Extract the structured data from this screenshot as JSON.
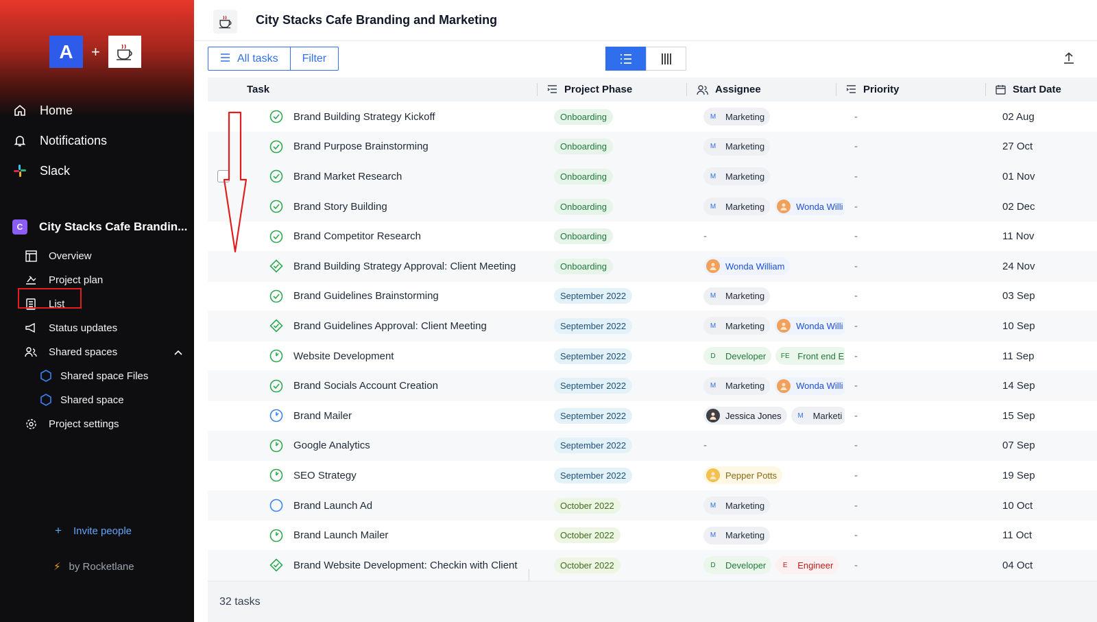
{
  "app": {
    "logo_letter": "A",
    "logo_plus": "+",
    "brand_color": "#2f5bea",
    "accent_color": "#2f6fed"
  },
  "sidebar": {
    "nav": [
      {
        "label": "Home",
        "icon": "home-icon"
      },
      {
        "label": "Notifications",
        "icon": "bell-icon"
      },
      {
        "label": "Slack",
        "icon": "slack-icon"
      }
    ],
    "project": {
      "badge": "C",
      "name": "City Stacks Cafe Brandin..."
    },
    "items": [
      {
        "label": "Overview",
        "icon": "overview-icon"
      },
      {
        "label": "Project plan",
        "icon": "project-plan-icon"
      },
      {
        "label": "List",
        "icon": "list-icon"
      },
      {
        "label": "Status updates",
        "icon": "megaphone-icon"
      },
      {
        "label": "Shared spaces",
        "icon": "people-icon"
      }
    ],
    "shared_spaces": [
      {
        "label": "Shared space Files",
        "icon": "hexagon-icon"
      },
      {
        "label": "Shared space",
        "icon": "hexagon-icon"
      }
    ],
    "settings": {
      "label": "Project settings",
      "icon": "gear-icon"
    },
    "invite": {
      "plus": "+",
      "label": "Invite people"
    },
    "powered": {
      "bolt": "⚡",
      "label": "by Rocketlane"
    }
  },
  "header": {
    "title": "City Stacks Cafe Branding and Marketing"
  },
  "toolbar": {
    "all_tasks": "All tasks",
    "filter": "Filter"
  },
  "table": {
    "columns": {
      "task": "Task",
      "phase": "Project Phase",
      "assignee": "Assignee",
      "priority": "Priority",
      "start": "Start Date"
    },
    "rows": [
      {
        "status": "done",
        "task": "Brand Building Strategy Kickoff",
        "phase": "Onboarding",
        "ptype": "onb",
        "assignees": [
          {
            "kind": "team",
            "initial": "M",
            "name": "Marketing"
          }
        ],
        "priority": "-",
        "start": "02 Aug"
      },
      {
        "status": "done",
        "task": "Brand Purpose Brainstorming",
        "phase": "Onboarding",
        "ptype": "onb",
        "assignees": [
          {
            "kind": "team",
            "initial": "M",
            "name": "Marketing"
          }
        ],
        "priority": "-",
        "start": "27 Oct"
      },
      {
        "status": "done",
        "task": "Brand Market Research",
        "phase": "Onboarding",
        "ptype": "onb",
        "assignees": [
          {
            "kind": "team",
            "initial": "M",
            "name": "Marketing"
          }
        ],
        "priority": "-",
        "start": "01 Nov",
        "checkbox": true
      },
      {
        "status": "done",
        "task": "Brand Story Building",
        "phase": "Onboarding",
        "ptype": "onb",
        "assignees": [
          {
            "kind": "team",
            "initial": "M",
            "name": "Marketing"
          },
          {
            "kind": "person",
            "name": "Wonda Willi"
          }
        ],
        "priority": "-",
        "start": "02 Dec"
      },
      {
        "status": "done",
        "task": "Brand Competitor Research",
        "phase": "Onboarding",
        "ptype": "onb",
        "assignees": [],
        "assignee_empty": "-",
        "priority": "-",
        "start": "11 Nov"
      },
      {
        "status": "milestone",
        "task": "Brand Building Strategy Approval: Client Meeting",
        "phase": "Onboarding",
        "ptype": "onb",
        "assignees": [
          {
            "kind": "person",
            "name": "Wonda William"
          }
        ],
        "priority": "-",
        "start": "24 Nov"
      },
      {
        "status": "done",
        "task": "Brand Guidelines Brainstorming",
        "phase": "September 2022",
        "ptype": "sep",
        "assignees": [
          {
            "kind": "team",
            "initial": "M",
            "name": "Marketing"
          }
        ],
        "priority": "-",
        "start": "03 Sep"
      },
      {
        "status": "milestone",
        "task": "Brand Guidelines Approval: Client Meeting",
        "phase": "September 2022",
        "ptype": "sep",
        "assignees": [
          {
            "kind": "team",
            "initial": "M",
            "name": "Marketing"
          },
          {
            "kind": "person",
            "name": "Wonda Willi"
          }
        ],
        "priority": "-",
        "start": "10 Sep"
      },
      {
        "status": "progress",
        "task": "Website Development",
        "phase": "September 2022",
        "ptype": "sep",
        "assignees": [
          {
            "kind": "dev",
            "initial": "D",
            "name": "Developer"
          },
          {
            "kind": "dev",
            "initial": "FE",
            "name": "Front end E"
          }
        ],
        "priority": "-",
        "start": "11 Sep"
      },
      {
        "status": "done",
        "task": "Brand Socials Account Creation",
        "phase": "September 2022",
        "ptype": "sep",
        "assignees": [
          {
            "kind": "team",
            "initial": "M",
            "name": "Marketing"
          },
          {
            "kind": "person",
            "name": "Wonda Willi"
          }
        ],
        "priority": "-",
        "start": "14 Sep"
      },
      {
        "status": "blue",
        "task": "Brand Mailer",
        "phase": "September 2022",
        "ptype": "sep",
        "assignees": [
          {
            "kind": "person2",
            "name": "Jessica Jones"
          },
          {
            "kind": "team",
            "initial": "M",
            "name": "Marketi"
          }
        ],
        "priority": "-",
        "start": "15 Sep"
      },
      {
        "status": "progress",
        "task": "Google Analytics",
        "phase": "September 2022",
        "ptype": "sep",
        "assignees": [],
        "assignee_empty": "-",
        "priority": "-",
        "start": "07 Sep"
      },
      {
        "status": "progress",
        "task": "SEO Strategy",
        "phase": "September 2022",
        "ptype": "sep",
        "assignees": [
          {
            "kind": "yellow",
            "name": "Pepper Potts"
          }
        ],
        "priority": "-",
        "start": "19 Sep"
      },
      {
        "status": "todo",
        "task": "Brand Launch Ad",
        "phase": "October 2022",
        "ptype": "oct",
        "assignees": [
          {
            "kind": "team",
            "initial": "M",
            "name": "Marketing"
          }
        ],
        "priority": "-",
        "start": "10 Oct"
      },
      {
        "status": "progress",
        "task": "Brand Launch Mailer",
        "phase": "October 2022",
        "ptype": "oct",
        "assignees": [
          {
            "kind": "team",
            "initial": "M",
            "name": "Marketing"
          }
        ],
        "priority": "-",
        "start": "11 Oct"
      },
      {
        "status": "milestone",
        "task": "Brand Website Development: Checkin with Client",
        "phase": "October 2022",
        "ptype": "oct",
        "assignees": [
          {
            "kind": "dev",
            "initial": "D",
            "name": "Developer"
          },
          {
            "kind": "red",
            "initial": "E",
            "name": "Engineer"
          }
        ],
        "priority": "-",
        "start": "04 Oct"
      }
    ],
    "footer": "32 tasks"
  }
}
